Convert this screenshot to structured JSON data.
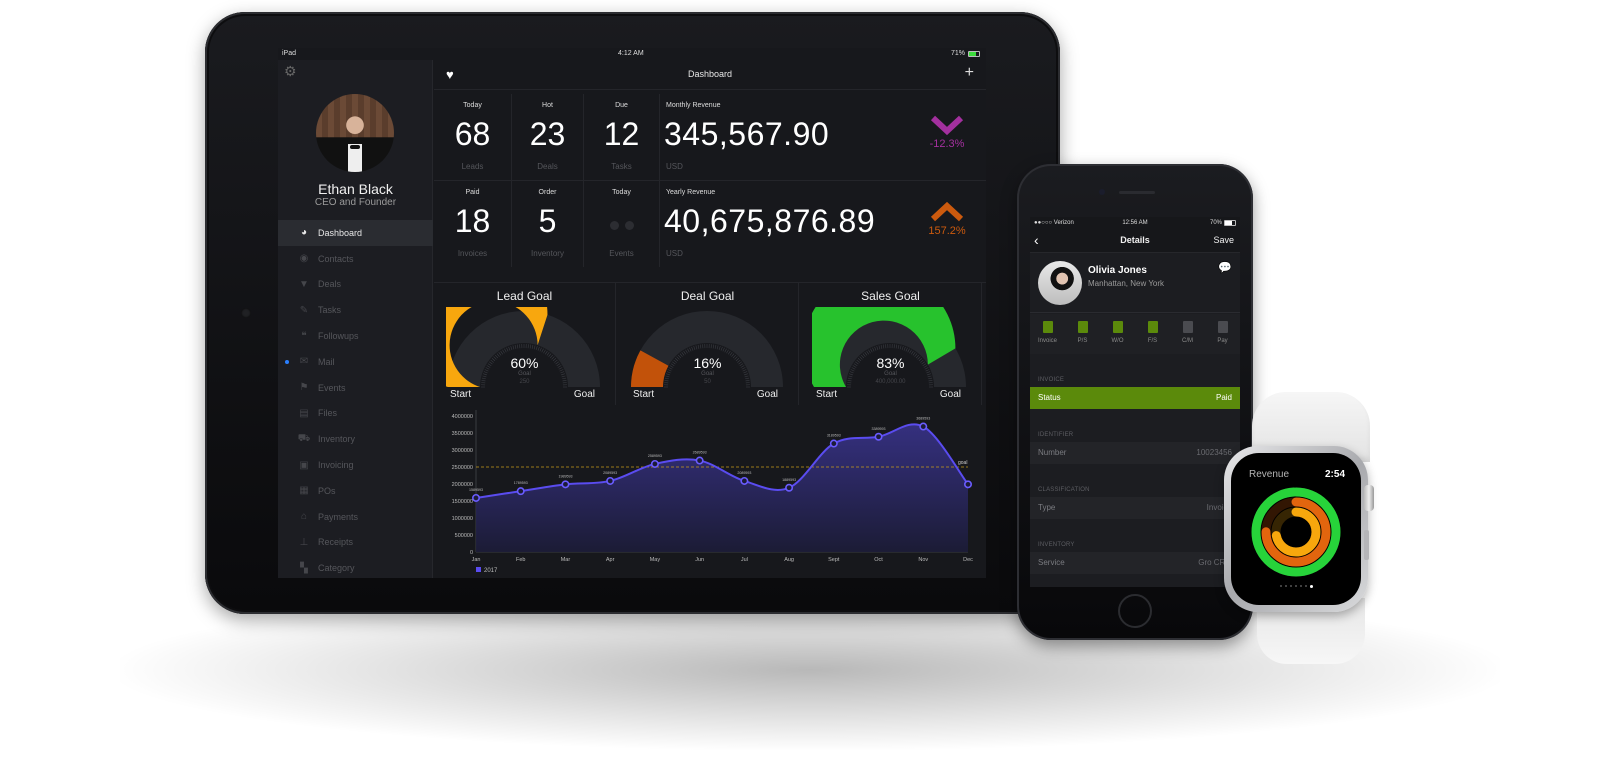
{
  "ipad": {
    "status": {
      "device": "iPad",
      "time": "4:12 AM",
      "battery": "71%"
    },
    "sidebar": {
      "profile": {
        "name": "Ethan Black",
        "role": "CEO and Founder"
      },
      "items": [
        {
          "label": "Dashboard",
          "icon": "dashboard-icon",
          "glyph": "◕",
          "active": true
        },
        {
          "label": "Contacts",
          "icon": "contacts-icon",
          "glyph": "◉"
        },
        {
          "label": "Deals",
          "icon": "filter-icon",
          "glyph": "▼"
        },
        {
          "label": "Tasks",
          "icon": "pencil-icon",
          "glyph": "✎"
        },
        {
          "label": "Followups",
          "icon": "chat-bubbles-icon",
          "glyph": "❝"
        },
        {
          "label": "Mail",
          "icon": "envelope-icon",
          "glyph": "✉",
          "unread": true
        },
        {
          "label": "Events",
          "icon": "flag-icon",
          "glyph": "⚑"
        },
        {
          "label": "Files",
          "icon": "archive-box-icon",
          "glyph": "▤"
        },
        {
          "label": "Inventory",
          "icon": "truck-icon",
          "glyph": "⛟"
        },
        {
          "label": "Invoicing",
          "icon": "shopping-bag-icon",
          "glyph": "▣"
        },
        {
          "label": "POs",
          "icon": "document-icon",
          "glyph": "▦"
        },
        {
          "label": "Payments",
          "icon": "bank-icon",
          "glyph": "⌂"
        },
        {
          "label": "Receipts",
          "icon": "pin-icon",
          "glyph": "⊥"
        },
        {
          "label": "Category",
          "icon": "category-icon",
          "glyph": "▚"
        }
      ]
    },
    "topbar": {
      "title": "Dashboard"
    },
    "stats": {
      "row1": [
        {
          "label": "Today",
          "value": "68",
          "sub": "Leads"
        },
        {
          "label": "Hot",
          "value": "23",
          "sub": "Deals"
        },
        {
          "label": "Due",
          "value": "12",
          "sub": "Tasks"
        }
      ],
      "row2": [
        {
          "label": "Paid",
          "value": "18",
          "sub": "Invoices"
        },
        {
          "label": "Order",
          "value": "5",
          "sub": "Inventory"
        },
        {
          "label": "Today",
          "value": "",
          "sub": "Events"
        }
      ],
      "monthly": {
        "label": "Monthly Revenue",
        "value": "345,567.90",
        "currency": "USD",
        "change": "-12.3%",
        "direction": "down",
        "color": "#a3309e"
      },
      "yearly": {
        "label": "Yearly Revenue",
        "value": "40,675,876.89",
        "currency": "USD",
        "change": "157.2%",
        "direction": "up",
        "color": "#cc5a0e"
      }
    },
    "gauges": [
      {
        "title": "Lead Goal",
        "percent": 60,
        "display": "60%",
        "goal_label": "Goal",
        "goal_value": "250",
        "start": "Start",
        "end": "Goal",
        "color": "#f8a70e"
      },
      {
        "title": "Deal Goal",
        "percent": 16,
        "display": "16%",
        "goal_label": "Goal",
        "goal_value": "50",
        "start": "Start",
        "end": "Goal",
        "color": "#c2520a"
      },
      {
        "title": "Sales Goal",
        "percent": 83,
        "display": "83%",
        "goal_label": "Goal",
        "goal_value": "400,000.00",
        "start": "Start",
        "end": "Goal",
        "color": "#27c22d"
      }
    ],
    "chart_data": {
      "type": "area",
      "title": "",
      "xlabel": "",
      "ylabel": "",
      "categories": [
        "Jan",
        "Feb",
        "Mar",
        "Apr",
        "May",
        "Jun",
        "Jul",
        "Aug",
        "Sept",
        "Oct",
        "Nov",
        "Dec"
      ],
      "series": [
        {
          "name": "2017",
          "color": "#5a4cf0",
          "values": [
            1589593,
            1789593,
            1989593,
            2089593,
            2589593,
            2689593,
            2089593,
            1889593,
            3189593,
            3389593,
            3689593,
            1989593
          ],
          "labels": [
            "1589593",
            "1789593",
            "1989593",
            "2089593",
            "2589593",
            "2689593",
            "2089593",
            "1889593",
            "3189593",
            "3389593",
            "3689593",
            ""
          ]
        }
      ],
      "goal_line": {
        "value": 2500000,
        "label": "goal",
        "color": "#c89a1a"
      },
      "yticks": [
        0,
        500000,
        1000000,
        1500000,
        2000000,
        2500000,
        3000000,
        3500000,
        4000000
      ],
      "ylim": [
        0,
        4000000
      ],
      "grid": false,
      "legend": "bottom-left"
    }
  },
  "iphone": {
    "status": {
      "carrier": "●●○○○ Verizon",
      "time": "12:56 AM",
      "battery": "70%"
    },
    "nav": {
      "back": "‹",
      "title": "Details",
      "save": "Save"
    },
    "contact": {
      "name": "Olivia Jones",
      "location": "Manhattan, New York"
    },
    "actions": [
      {
        "label": "Invoice",
        "icon": "invoice-icon",
        "color": "#5b8a0b"
      },
      {
        "label": "P/S",
        "icon": "box-icon",
        "color": "#5b8a0b"
      },
      {
        "label": "W/O",
        "icon": "wrench-icon",
        "color": "#5b8a0b"
      },
      {
        "label": "F/S",
        "icon": "area-chart-icon",
        "color": "#5b8a0b"
      },
      {
        "label": "C/M",
        "icon": "note-icon",
        "color": "#4a4b50"
      },
      {
        "label": "Pay",
        "icon": "card-icon",
        "color": "#4a4b50"
      }
    ],
    "sections": [
      {
        "header": "INVOICE",
        "key": "Status",
        "value": "Paid",
        "highlight": true
      },
      {
        "header": "IDENTIFIER",
        "key": "Number",
        "value": "10023456"
      },
      {
        "header": "CLASSIFICATION",
        "key": "Type",
        "value": "Invoice"
      },
      {
        "header": "INVENTORY",
        "key": "Service",
        "value": "Gro CRM"
      }
    ]
  },
  "watch": {
    "title": "Revenue",
    "time": "2:54",
    "rings": [
      {
        "name": "outer",
        "progress": 0.99,
        "color": "#27d33a"
      },
      {
        "name": "middle",
        "progress": 0.75,
        "color": "#e2650e"
      },
      {
        "name": "inner",
        "progress": 0.72,
        "color": "#f7a70d"
      }
    ],
    "pages": 7,
    "active_page": 7
  }
}
